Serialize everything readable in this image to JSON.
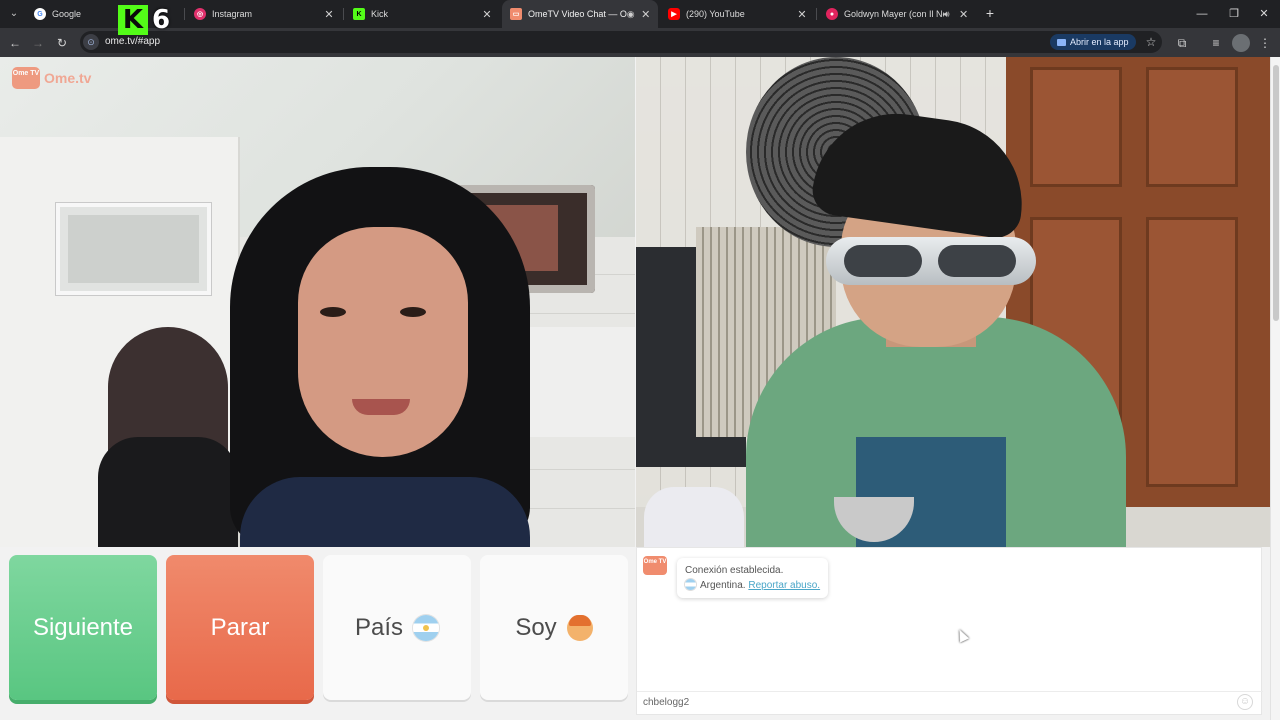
{
  "browser": {
    "tabs": [
      {
        "title": "Google",
        "icon": "google-icon",
        "color": "#ffffff",
        "active": false
      },
      {
        "title": "Instagram",
        "icon": "instagram-icon",
        "color": "#e1306c",
        "active": false
      },
      {
        "title": "Kick",
        "icon": "kick-icon",
        "color": "#53fc18",
        "active": false
      },
      {
        "title": "OmeTV Video Chat — Ome",
        "icon": "ometv-icon",
        "color": "#f08c6e",
        "active": true
      },
      {
        "title": "(290) YouTube",
        "icon": "youtube-icon",
        "color": "#ff0000",
        "active": false
      },
      {
        "title": "Goldwyn Mayer (con Il Nen",
        "icon": "tab-favicon",
        "color": "#e0245e",
        "active": false
      }
    ],
    "url": "ome.tv/#app",
    "open_in_app": "Abrir en la app",
    "overlay_badge": {
      "letter": "K",
      "number": "6"
    }
  },
  "site": {
    "logo_box": "Ome TV",
    "logo_text": "Ome.tv"
  },
  "controls": {
    "next_label": "Siguiente",
    "stop_label": "Parar",
    "country_label": "País",
    "me_label": "Soy"
  },
  "chat": {
    "status": "Conexión establecida.",
    "country": "Argentina.",
    "report_link": "Reportar abuso.",
    "input_value": "chbelogg2"
  },
  "colors": {
    "next": "#59c681",
    "stop": "#e8694a",
    "accent": "#f08c6e",
    "link": "#4aa6c8"
  }
}
